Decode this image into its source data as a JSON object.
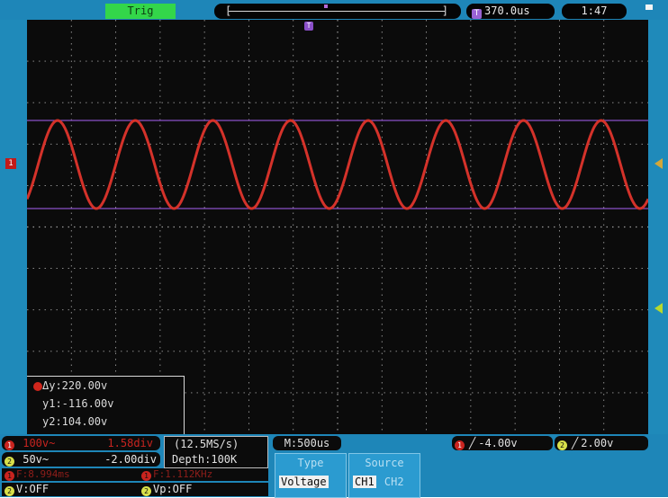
{
  "top_bar": {
    "trig_status": "Trig",
    "trigger_position": "370.0us",
    "trigger_position_badge": "T",
    "clock": "1:47"
  },
  "waveform": {
    "channel": "CH1",
    "color": "#d4322a",
    "cycles_visible": 8,
    "cursor_color": "#8a4fc8",
    "ch1_marker_label": "1",
    "t_marker_label": "T"
  },
  "cursor_readout": {
    "delta": "Δy:220.00v",
    "y1": "y1:-116.00v",
    "y2": "y2:104.00v"
  },
  "ch1": {
    "badge": "1",
    "volts_div": "100v~",
    "position": "1.58div",
    "color": "#c9241f"
  },
  "ch2": {
    "badge": "2",
    "volts_div": "50v~",
    "position": "-2.00div",
    "color": "#d8e04a"
  },
  "acquisition": {
    "sample_rate": "(12.5MS/s)",
    "depth": "Depth:100K"
  },
  "timebase": "M:500us",
  "trigger_ch1": {
    "badge": "1",
    "level": "-4.00v"
  },
  "trigger_ch2": {
    "badge": "2",
    "level": "2.00v"
  },
  "measurements": {
    "ch1_period": "F:8.994ms",
    "ch1_freq": "F:1.112KHz",
    "ch2_v": "V:OFF",
    "ch2_vp": "Vp:OFF",
    "ch1_badge": "1",
    "ch2_badge": "2"
  },
  "menu": {
    "type_title": "Type",
    "type_value": "Voltage",
    "source_title": "Source",
    "source_options": [
      "CH1",
      "CH2"
    ],
    "source_selected": "CH1"
  }
}
